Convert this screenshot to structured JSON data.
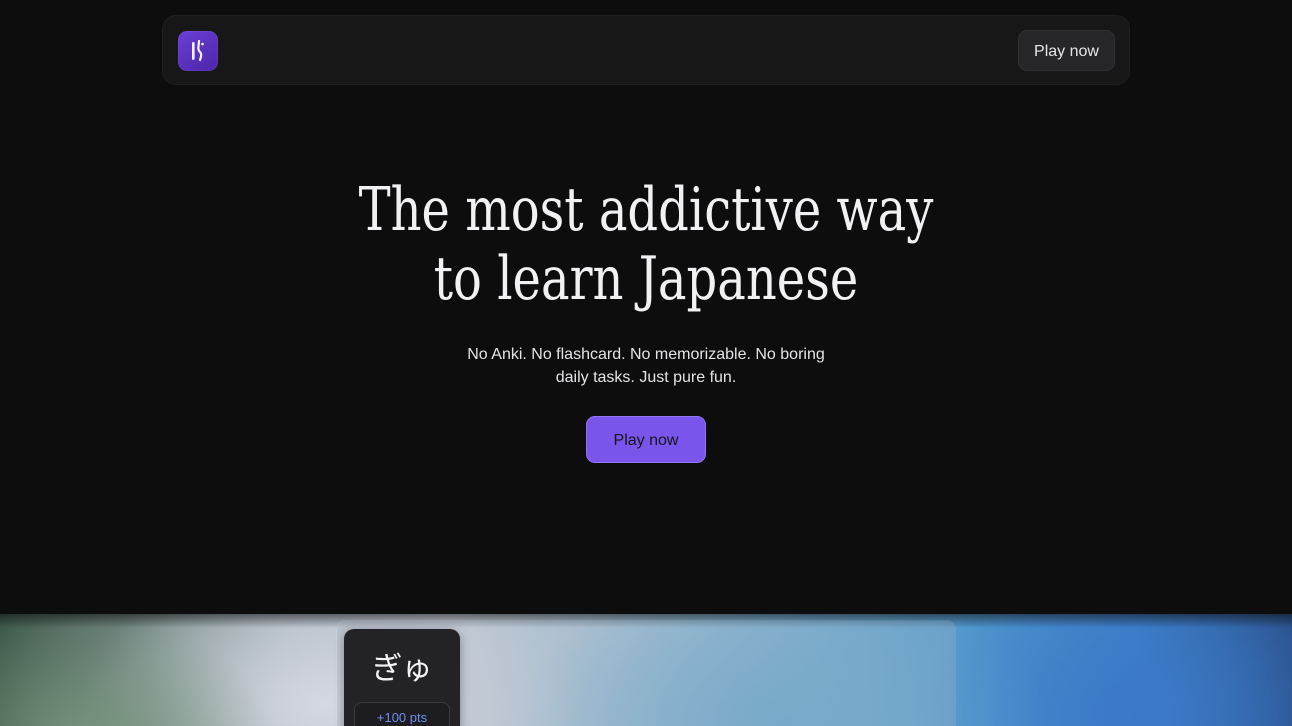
{
  "header": {
    "logo_icon": "brand-logo-icon",
    "logo_color": "#5b2fbf",
    "cta_label": "Play now"
  },
  "hero": {
    "title_line1": "The most addictive way",
    "title_line2": "to learn Japanese",
    "subtitle_line1": "No Anki. No flashcard. No memorizable. No boring",
    "subtitle_line2": "daily tasks. Just pure fun.",
    "cta_label": "Play now",
    "cta_color": "#7a55ec"
  },
  "showcase": {
    "kana": "ぎゅ",
    "points": "+100 pts",
    "points_color": "#6f8df0"
  }
}
